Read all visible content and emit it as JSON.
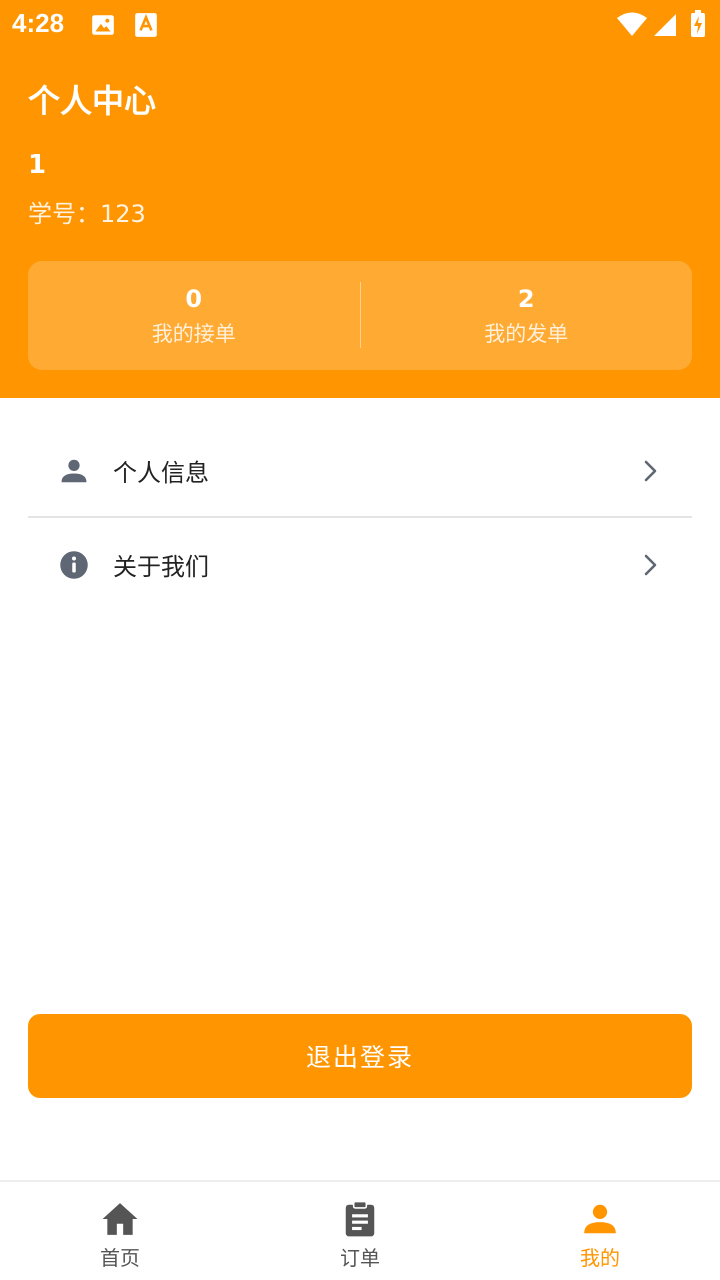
{
  "status_bar": {
    "time": "4:28"
  },
  "header": {
    "title": "个人中心",
    "user_name": "1",
    "student_id_label": "学号：",
    "student_id_value": "123"
  },
  "stats": [
    {
      "value": "0",
      "label": "我的接单"
    },
    {
      "value": "2",
      "label": "我的发单"
    }
  ],
  "menu": [
    {
      "label": "个人信息",
      "icon": "person-icon"
    },
    {
      "label": "关于我们",
      "icon": "info-icon"
    }
  ],
  "logout_label": "退出登录",
  "bottom_nav": [
    {
      "label": "首页",
      "icon": "home-icon",
      "active": false
    },
    {
      "label": "订单",
      "icon": "clipboard-icon",
      "active": false
    },
    {
      "label": "我的",
      "icon": "person-icon",
      "active": true
    }
  ],
  "colors": {
    "accent": "#FF9500",
    "icon_gray": "#5f6674"
  }
}
